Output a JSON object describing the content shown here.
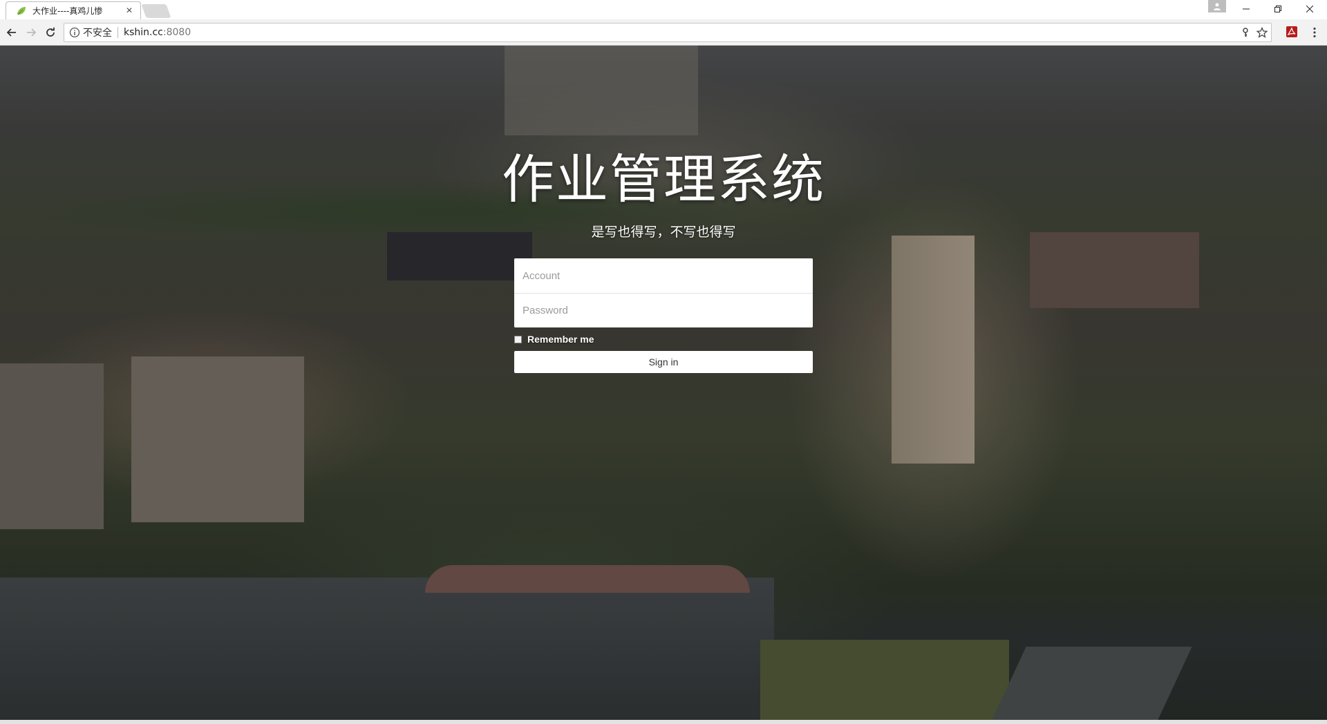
{
  "browser": {
    "tab": {
      "title": "大作业----真鸡儿惨"
    },
    "address": {
      "security_label": "不安全",
      "host": "kshin.cc",
      "port": ":8080"
    }
  },
  "page": {
    "title": "作业管理系统",
    "subtitle": "是写也得写，不写也得写",
    "form": {
      "account_placeholder": "Account",
      "password_placeholder": "Password",
      "remember_label": "Remember me",
      "signin_label": "Sign in"
    }
  },
  "icons": [
    "leaf-favicon-icon",
    "close-icon",
    "user-icon",
    "minimize-icon",
    "maximize-icon",
    "back-icon",
    "forward-icon",
    "reload-icon",
    "info-icon",
    "key-icon",
    "star-icon",
    "pdf-extension-icon",
    "menu-icon"
  ],
  "colors": {
    "chrome_bg": "#f2f2f2",
    "form_bg": "#ffffff",
    "title_text": "#ffffff"
  }
}
